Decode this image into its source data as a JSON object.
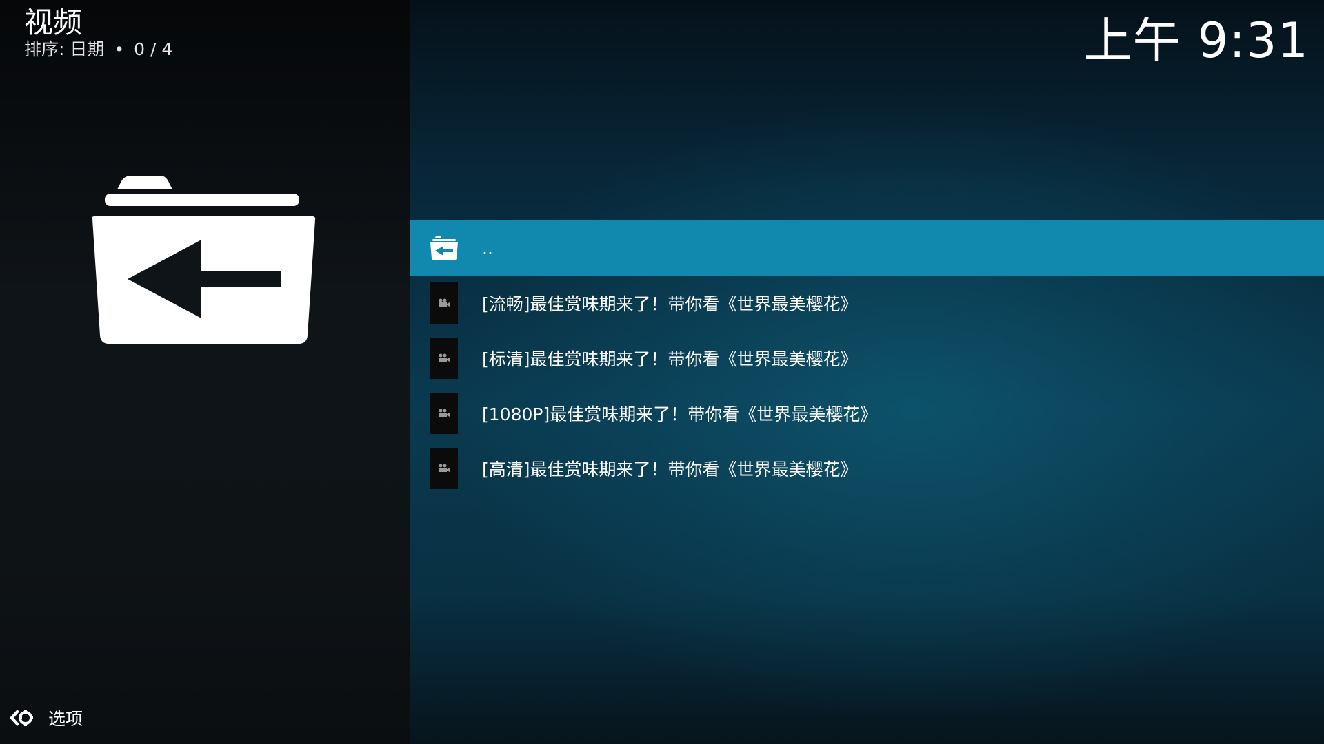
{
  "header": {
    "title": "视频",
    "sort_label": "排序: 日期",
    "separator": "•",
    "count": "0 / 4"
  },
  "clock": "上午 9:31",
  "options": {
    "label": "选项",
    "icon": "options-arrows-gear-icon"
  },
  "list": {
    "parent": {
      "label": "..",
      "icon": "folder-back-icon"
    },
    "items": [
      {
        "label": "[流畅]最佳赏味期来了！带你看《世界最美樱花》",
        "icon": "video-camera-icon"
      },
      {
        "label": "[标清]最佳赏味期来了！带你看《世界最美樱花》",
        "icon": "video-camera-icon"
      },
      {
        "label": "[1080P]最佳赏味期来了！带你看《世界最美樱花》",
        "icon": "video-camera-icon"
      },
      {
        "label": "[高清]最佳赏味期来了！带你看《世界最美樱花》",
        "icon": "video-camera-icon"
      }
    ]
  },
  "colors": {
    "selected_row": "#1188ae",
    "left_panel_bg": "#0f1418",
    "right_panel_accent": "#0a3a50"
  }
}
